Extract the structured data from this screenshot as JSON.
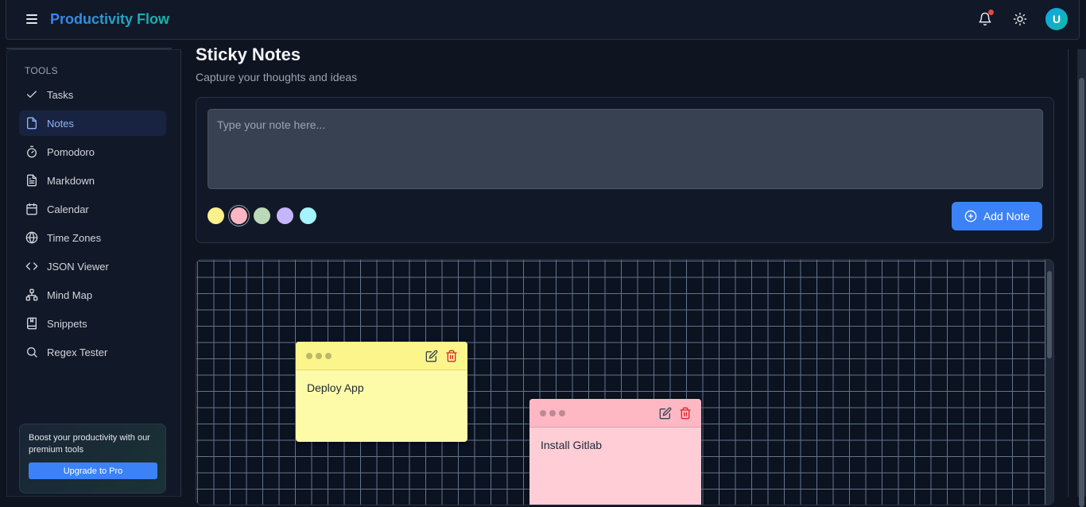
{
  "app": {
    "title": "Productivity Flow",
    "user_initial": "U"
  },
  "sidebar": {
    "heading": "TOOLS",
    "items": [
      {
        "label": "Tasks",
        "icon": "check-icon"
      },
      {
        "label": "Notes",
        "icon": "file-icon",
        "active": true
      },
      {
        "label": "Pomodoro",
        "icon": "timer-icon"
      },
      {
        "label": "Markdown",
        "icon": "file-text-icon"
      },
      {
        "label": "Calendar",
        "icon": "calendar-icon"
      },
      {
        "label": "Time Zones",
        "icon": "globe-icon"
      },
      {
        "label": "JSON Viewer",
        "icon": "code-icon"
      },
      {
        "label": "Mind Map",
        "icon": "network-icon"
      },
      {
        "label": "Snippets",
        "icon": "bookmark-icon"
      },
      {
        "label": "Regex Tester",
        "icon": "search-icon"
      }
    ],
    "promo": {
      "text": "Boost your productivity with our premium tools",
      "button": "Upgrade to Pro"
    }
  },
  "page": {
    "title": "Sticky Notes",
    "subtitle": "Capture your thoughts and ideas"
  },
  "composer": {
    "placeholder": "Type your note here...",
    "add_label": "Add Note",
    "colors": [
      "#fef08a",
      "#fbb6c3",
      "#bbd9b8",
      "#c4b5fd",
      "#a5f3fc"
    ],
    "selected_color": 1
  },
  "notes": [
    {
      "text": "Deploy App",
      "color": "yellow"
    },
    {
      "text": "Install Gitlab",
      "color": "pink"
    }
  ]
}
